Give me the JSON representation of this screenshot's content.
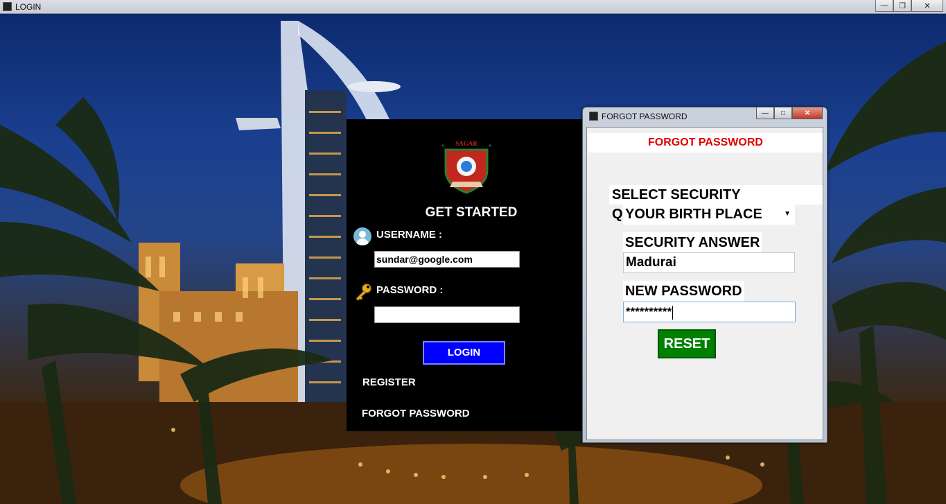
{
  "window": {
    "title": "LOGIN",
    "minimize": "—",
    "maximize": "❐",
    "close": "✕"
  },
  "login": {
    "logo_text": "SAGAR",
    "heading": "GET STARTED",
    "username_label": "USERNAME :",
    "username_value": "sundar@google.com",
    "password_label": "PASSWORD :",
    "password_value": "",
    "login_button": "LOGIN",
    "register_link": "REGISTER",
    "forgot_link": "FORGOT PASSWORD"
  },
  "dialog": {
    "title": "FORGOT PASSWORD",
    "minimize": "—",
    "maximize": "□",
    "close": "✕",
    "header": "FORGOT PASSWORD",
    "question_label": "SELECT SECURITY QUESTION:",
    "question_value": "YOUR BIRTH PLACE",
    "dropdown_arrow": "▼",
    "answer_label": "SECURITY ANSWER",
    "answer_value": "Madurai",
    "new_password_label": "NEW PASSWORD",
    "new_password_value": "**********",
    "reset_button": "RESET"
  },
  "colors": {
    "login_button": "#0000ff",
    "reset_button": "#008000",
    "dialog_header_text": "#e00000"
  }
}
